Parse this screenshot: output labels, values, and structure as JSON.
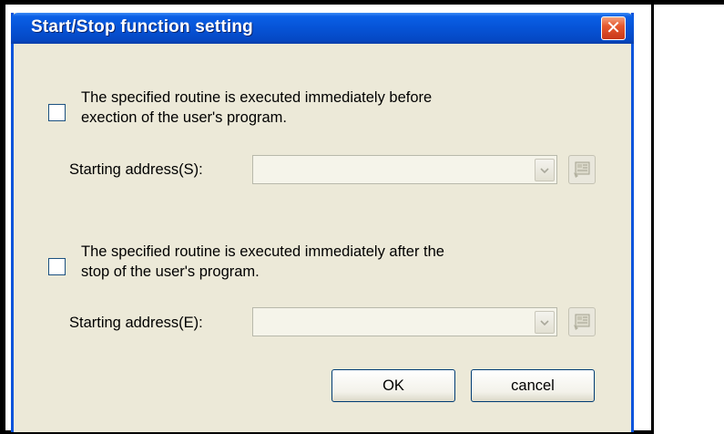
{
  "dialog": {
    "title": "Start/Stop function setting",
    "close_icon": "close-icon"
  },
  "start_section": {
    "checked": false,
    "description_line1": "The specified routine is executed immediately before",
    "description_line2": "exection of the user's program.",
    "address_label": "Starting address(S):",
    "address_value": ""
  },
  "stop_section": {
    "checked": false,
    "description_line1": "The specified routine is executed immediately after the",
    "description_line2": "stop of the user's program.",
    "address_label": "Starting address(E):",
    "address_value": ""
  },
  "buttons": {
    "ok_label": "OK",
    "cancel_label": "cancel"
  },
  "colors": {
    "title_bar": "#0653d6",
    "dialog_bg": "#ece9d8",
    "close_button": "#e5582e"
  }
}
